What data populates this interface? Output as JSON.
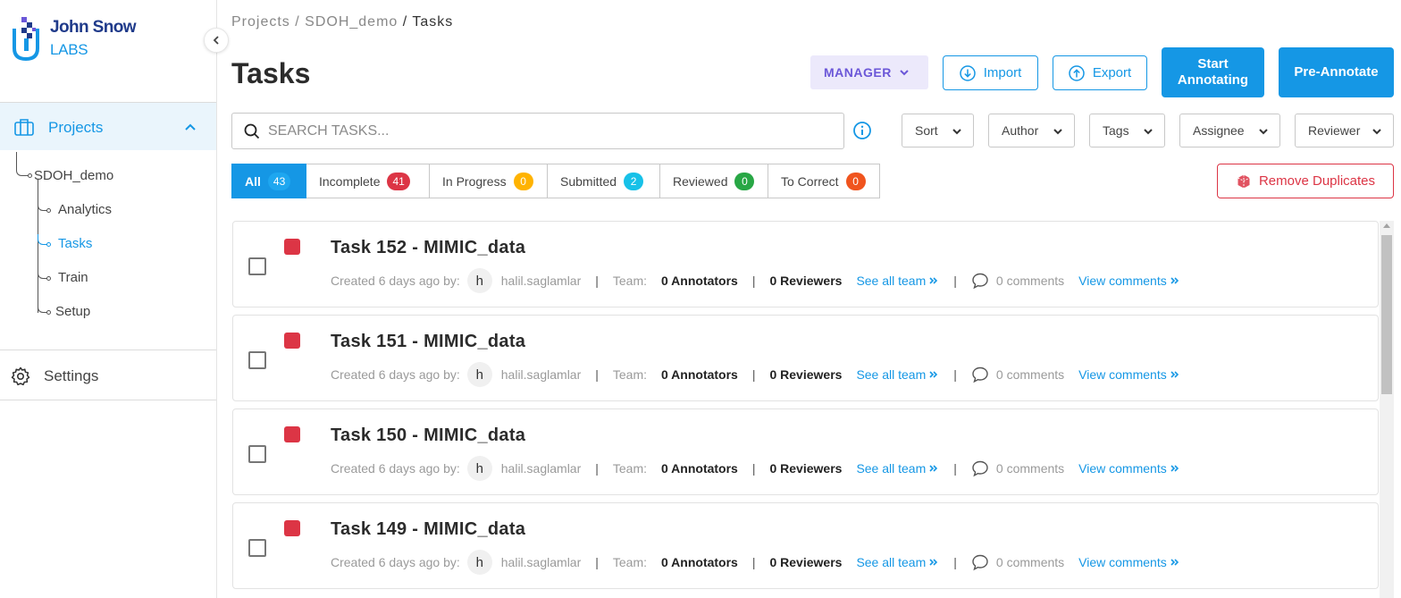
{
  "brand": {
    "line1": "John Snow",
    "line2": "LABS"
  },
  "sidebar": {
    "projects_label": "Projects",
    "project_name": "SDOH_demo",
    "sub_items": [
      "Analytics",
      "Tasks",
      "Train",
      "Setup"
    ],
    "active_item": "Tasks",
    "settings_label": "Settings"
  },
  "breadcrumb": {
    "part1": "Projects",
    "part2": "SDOH_demo",
    "current": "Tasks",
    "sep": "/"
  },
  "header": {
    "title": "Tasks",
    "role_label": "MANAGER",
    "import_label": "Import",
    "export_label": "Export",
    "start_label_1": "Start",
    "start_label_2": "Annotating",
    "preannotate_label": "Pre-Annotate"
  },
  "search": {
    "placeholder": "SEARCH TASKS..."
  },
  "filters": [
    "Sort",
    "Author",
    "Tags",
    "Assignee",
    "Reviewer"
  ],
  "tabs": [
    {
      "label": "All",
      "count": "43",
      "color": "#1ea7f0"
    },
    {
      "label": "Incomplete",
      "count": "41",
      "color": "#dc3545"
    },
    {
      "label": "In Progress",
      "count": "0",
      "color": "#ffb300"
    },
    {
      "label": "Submitted",
      "count": "2",
      "color": "#17c1e8"
    },
    {
      "label": "Reviewed",
      "count": "0",
      "color": "#28a745"
    },
    {
      "label": "To Correct",
      "count": "0",
      "color": "#f0541e"
    }
  ],
  "remove_duplicates_label": "Remove Duplicates",
  "meta_labels": {
    "created": "Created 6 days ago by:",
    "team": "Team:",
    "see_all_team": "See all team",
    "view_comments": "View comments"
  },
  "tasks": [
    {
      "title": "Task 152 - MIMIC_data",
      "avatar": "h",
      "author": "halil.saglamlar",
      "annotators": "0 Annotators",
      "reviewers": "0 Reviewers",
      "comments": "0 comments"
    },
    {
      "title": "Task 151 - MIMIC_data",
      "avatar": "h",
      "author": "halil.saglamlar",
      "annotators": "0 Annotators",
      "reviewers": "0 Reviewers",
      "comments": "0 comments"
    },
    {
      "title": "Task 150 - MIMIC_data",
      "avatar": "h",
      "author": "halil.saglamlar",
      "annotators": "0 Annotators",
      "reviewers": "0 Reviewers",
      "comments": "0 comments"
    },
    {
      "title": "Task 149 - MIMIC_data",
      "avatar": "h",
      "author": "halil.saglamlar",
      "annotators": "0 Annotators",
      "reviewers": "0 Reviewers",
      "comments": "0 comments"
    }
  ],
  "colors": {
    "accent": "#1597e5",
    "danger": "#dc3545",
    "manager_bg": "#ece9fb",
    "manager_text": "#6b57d8"
  }
}
